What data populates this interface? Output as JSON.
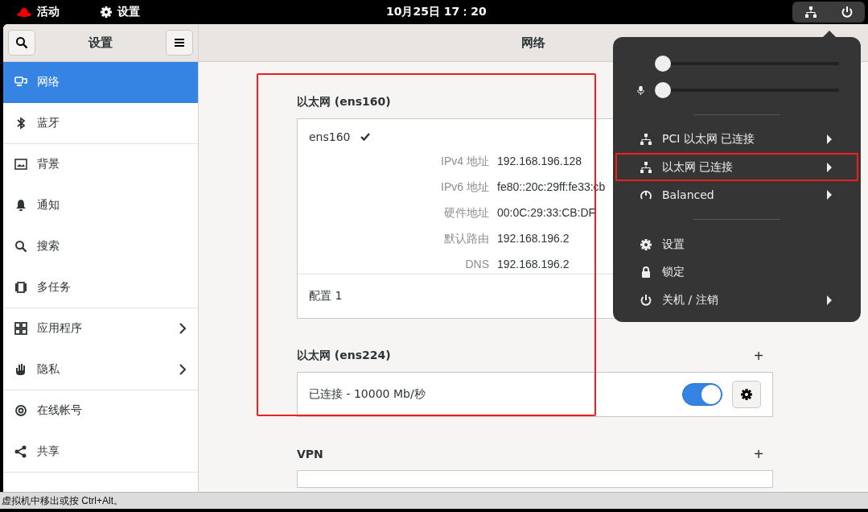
{
  "top_bar": {
    "activities": "活动",
    "app": "设置",
    "clock": "10月25日  17：20"
  },
  "sidebar": {
    "title": "设置",
    "items": [
      {
        "label": "网络",
        "selected": true,
        "divider": false,
        "arrow": false
      },
      {
        "label": "蓝牙",
        "selected": false,
        "divider": true,
        "arrow": false
      },
      {
        "label": "背景",
        "selected": false,
        "divider": false,
        "arrow": false
      },
      {
        "label": "通知",
        "selected": false,
        "divider": false,
        "arrow": false
      },
      {
        "label": "搜索",
        "selected": false,
        "divider": false,
        "arrow": false
      },
      {
        "label": "多任务",
        "selected": false,
        "divider": true,
        "arrow": false
      },
      {
        "label": "应用程序",
        "selected": false,
        "divider": false,
        "arrow": true
      },
      {
        "label": "隐私",
        "selected": false,
        "divider": true,
        "arrow": true
      },
      {
        "label": "在线帐号",
        "selected": false,
        "divider": false,
        "arrow": false
      },
      {
        "label": "共享",
        "selected": false,
        "divider": true,
        "arrow": false
      }
    ]
  },
  "content": {
    "title": "网络",
    "highlight_box": true,
    "device": {
      "title": "以太网 (ens160)",
      "name": "ens160",
      "active": true,
      "details": [
        {
          "label": "IPv4 地址",
          "value": "192.168.196.128"
        },
        {
          "label": "IPv6 地址",
          "value": "fe80::20c:29ff:fe33:cb"
        },
        {
          "label": "硬件地址",
          "value": "00:0C:29:33:CB:DF"
        },
        {
          "label": "默认路由",
          "value": "192.168.196.2"
        },
        {
          "label": "DNS",
          "value": "192.168.196.2"
        }
      ],
      "profile": "配置 1"
    },
    "sections": [
      {
        "title": "以太网 (ens224)",
        "add": "+",
        "status": "已连接 - 10000 Mb/秒",
        "on": true
      },
      {
        "title": "VPN",
        "add": "+"
      }
    ]
  },
  "menu": {
    "sliders": [
      {
        "kind": "volume",
        "level": 0
      },
      {
        "kind": "mic",
        "level": 0
      }
    ],
    "groups": [
      [
        {
          "label": "PCI 以太网 已连接",
          "submenu": true,
          "highlighted": false
        },
        {
          "label": "以太网 已连接",
          "submenu": true,
          "highlighted": true
        },
        {
          "label": "Balanced",
          "submenu": true,
          "highlighted": false
        }
      ],
      [
        {
          "label": "设置",
          "submenu": false,
          "highlighted": false
        },
        {
          "label": "锁定",
          "submenu": false,
          "highlighted": false
        },
        {
          "label": "关机 / 注销",
          "submenu": true,
          "highlighted": false
        }
      ]
    ]
  },
  "status_bar": "虚拟机中移出或按 Ctrl+Alt。"
}
